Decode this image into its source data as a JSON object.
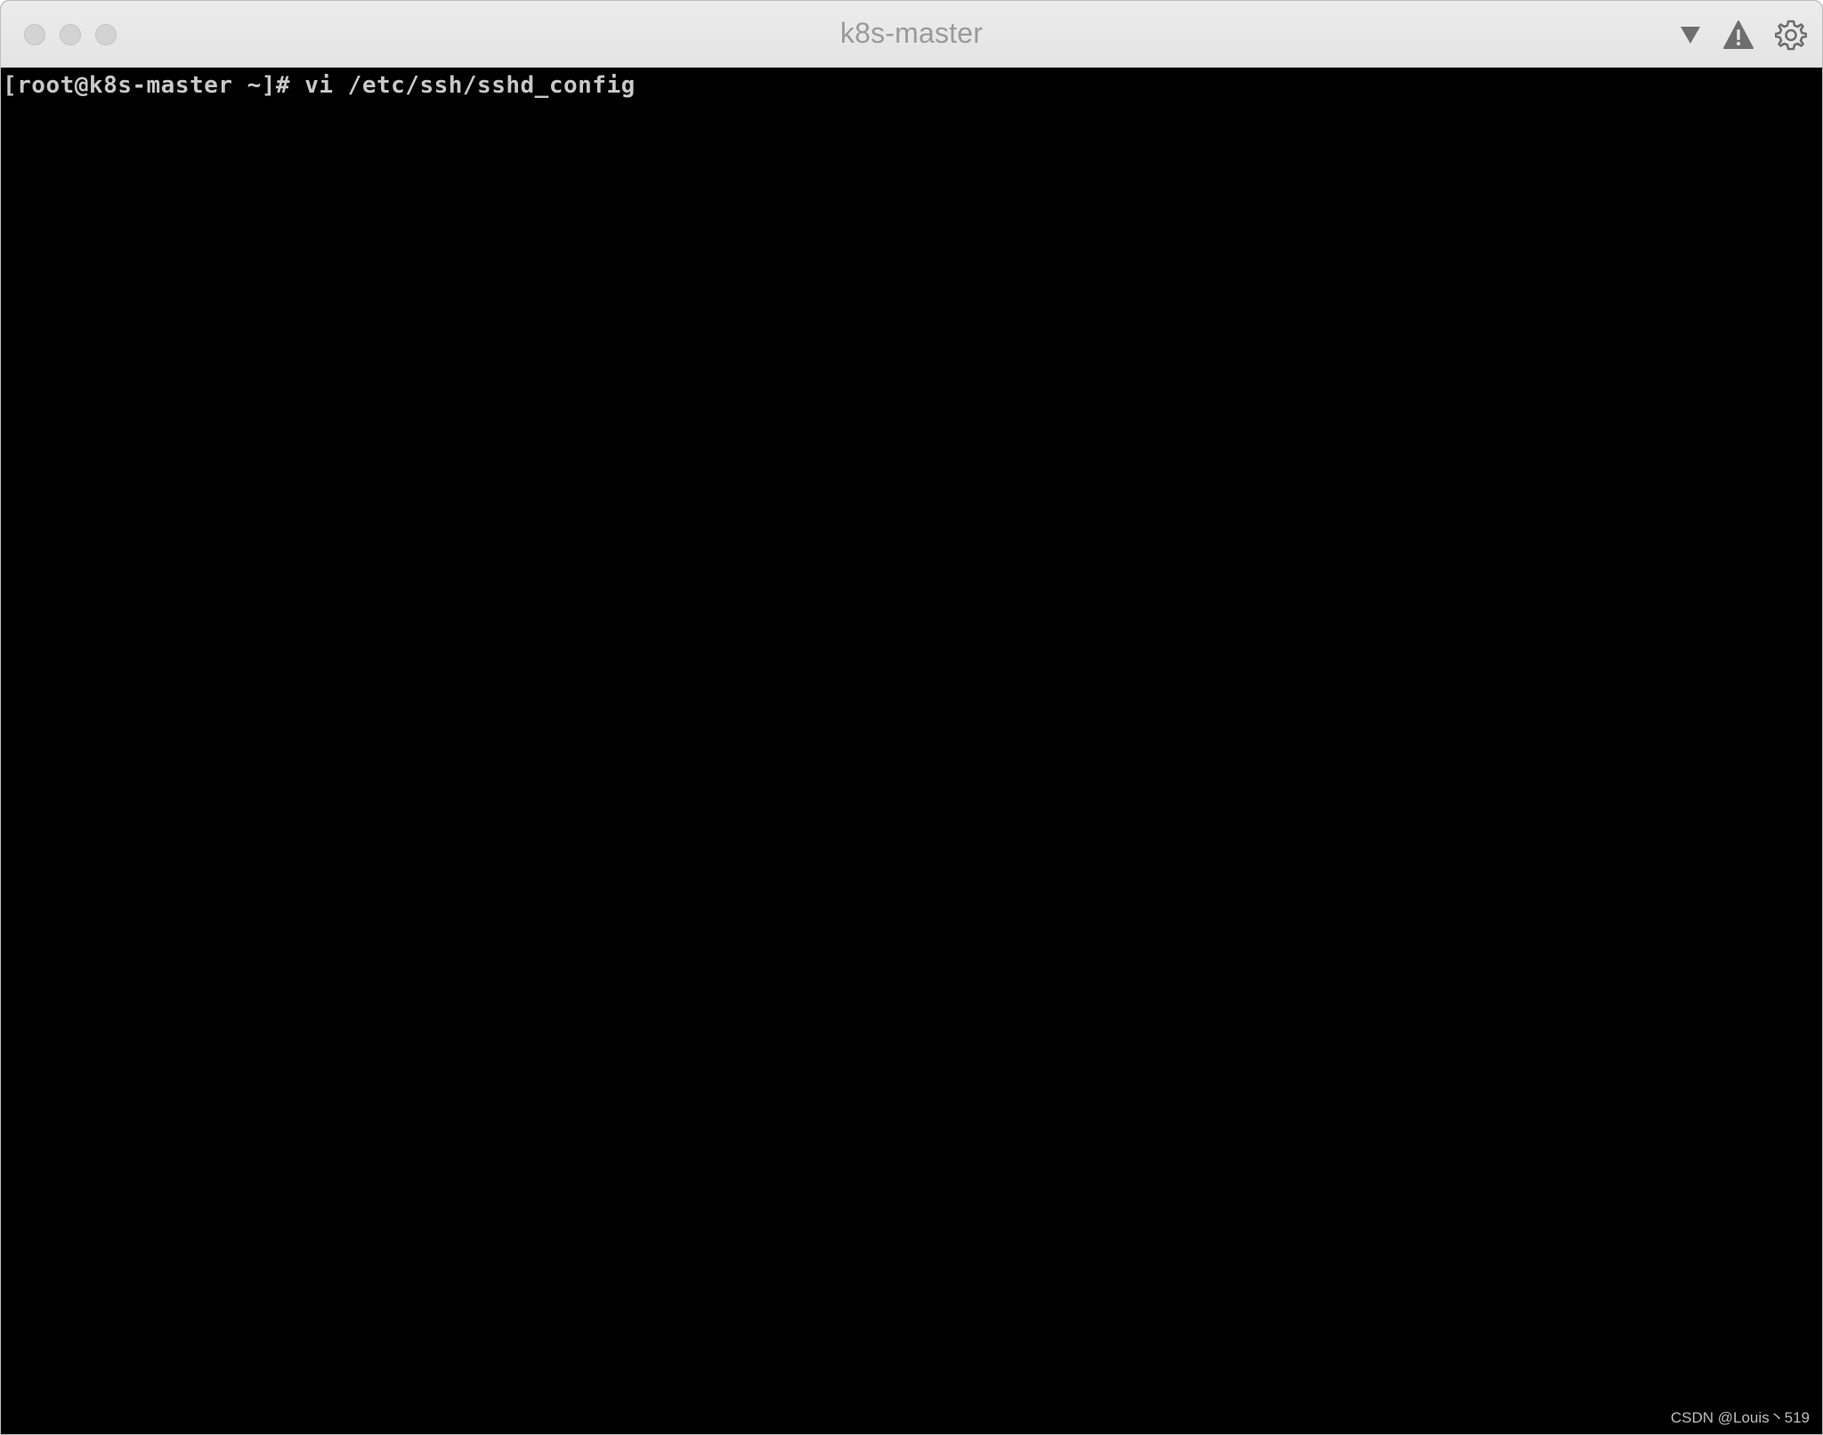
{
  "window": {
    "title": "k8s-master"
  },
  "toolbar": {
    "icons": [
      "chevron-down-icon",
      "warning-icon",
      "gear-icon"
    ]
  },
  "terminal": {
    "lines": [
      "[root@k8s-master ~]# vi /etc/ssh/sshd_config"
    ]
  },
  "watermark": "CSDN @Louis丶519",
  "colors": {
    "titlebar": "#e8e8e8",
    "title_text": "#9a9a9a",
    "terminal_bg": "#000000",
    "terminal_text": "#c8c8c8",
    "icon": "#6e6e6e"
  }
}
